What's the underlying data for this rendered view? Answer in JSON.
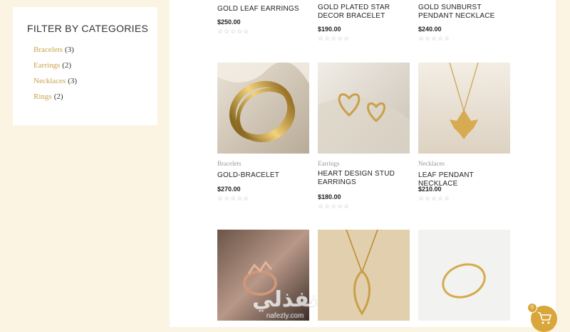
{
  "sidebar": {
    "title": "FILTER BY CATEGORIES",
    "categories": [
      {
        "label": "Bracelets",
        "count": "(3)"
      },
      {
        "label": "Earrings",
        "count": "(2)"
      },
      {
        "label": "Necklaces",
        "count": "(3)"
      },
      {
        "label": "Rings",
        "count": "(2)"
      }
    ]
  },
  "products": [
    {
      "name": "GOLD LEAF EARRINGS",
      "category": "",
      "price": "$250.00"
    },
    {
      "name": "GOLD PLATED STAR DECOR BRACELET",
      "category": "",
      "price": "$190.00"
    },
    {
      "name": "GOLD SUNBURST PENDANT NECKLACE",
      "category": "",
      "price": "$240.00"
    },
    {
      "name": "GOLD-BRACELET",
      "category": "Bracelets",
      "price": "$270.00"
    },
    {
      "name": "HEART DESIGN STUD EARRINGS",
      "category": "Earrings",
      "price": "$180.00"
    },
    {
      "name": "LEAF PENDANT NECKLACE",
      "category": "Necklaces",
      "price": "$210.00"
    },
    {
      "name": "",
      "category": "",
      "price": ""
    },
    {
      "name": "",
      "category": "",
      "price": ""
    },
    {
      "name": "",
      "category": "",
      "price": ""
    }
  ],
  "rating": {
    "stars_text": "☆☆☆☆☆",
    "value": 0
  },
  "cart": {
    "count": "0"
  },
  "watermark": {
    "text": "نفذلي",
    "subtext": "nafezly.com"
  },
  "colors": {
    "accent": "#c8a24a",
    "page_bg": "#fbf4e2",
    "card_bg": "#ffffff",
    "cart": "#d8a63a"
  },
  "icons": [
    "cart-icon",
    "star-icon"
  ]
}
